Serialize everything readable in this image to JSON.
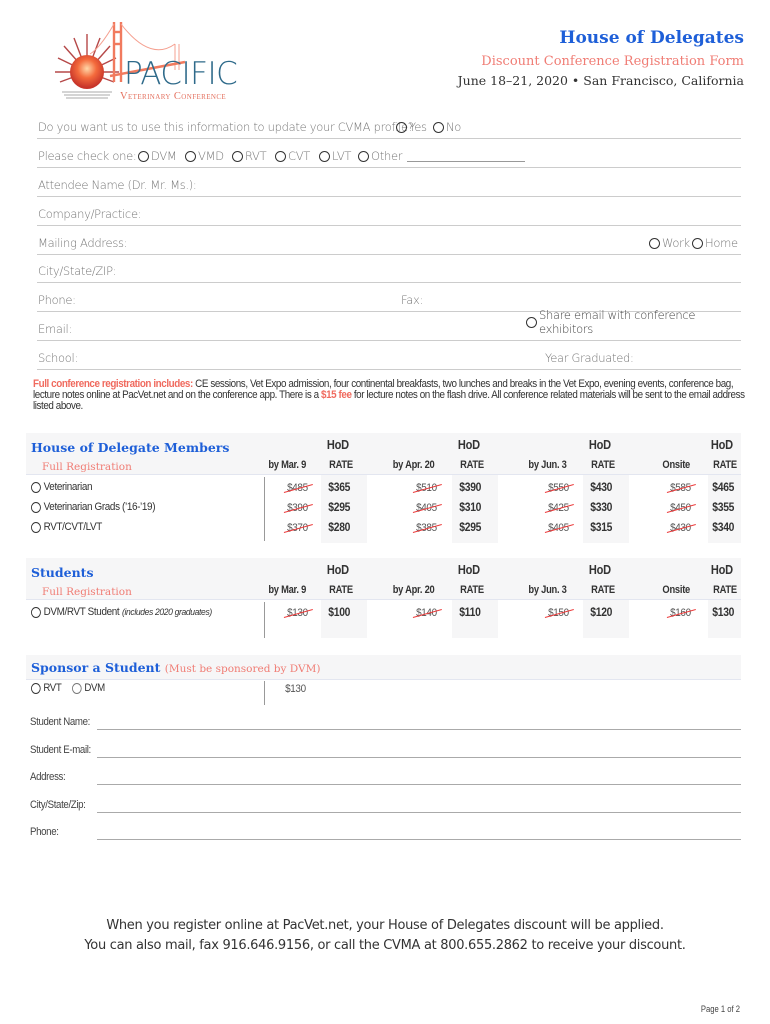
{
  "logo": {
    "name": "PACIFIC",
    "subtitle": "Veterinary Conference",
    "icon": "golden-gate-bridge-sun-icon"
  },
  "header": {
    "title": "House of Delegates",
    "subtitle": "Discount Conference Registration Form",
    "date_location": "June 18–21, 2020 •  San Francisco, California"
  },
  "colors": {
    "blue": "#1e5fd8",
    "coral": "#f07d75",
    "strike_red": "#ec3a3a",
    "band_gray": "#f6f6f7"
  },
  "form": {
    "update_profile": {
      "label": "Do you want us to use this information to update your CVMA profile?",
      "options": [
        "Yes",
        "No"
      ]
    },
    "check_one": {
      "label": "Please check one:",
      "options": [
        "DVM",
        "VMD",
        "RVT",
        "CVT",
        "LVT",
        "Other"
      ]
    },
    "attendee_name": "Attendee Name (Dr. Mr. Ms.):",
    "company": "Company/Practice:",
    "mailing_address": {
      "label": "Mailing Address:",
      "options": [
        "Work",
        "Home"
      ]
    },
    "city_state_zip": "City/State/ZIP:",
    "phone": "Phone:",
    "fax": "Fax:",
    "email": {
      "label": "Email:",
      "share_option": "Share email with conference exhibitors"
    },
    "school": "School:",
    "year_graduated": "Year Graduated:"
  },
  "note": {
    "lead": "Full conference registration includes:",
    "body1": " CE sessions, Vet Expo admission, four continental breakfasts, two lunches and breaks in the Vet Expo, evening events, conference bag, lecture notes online at PacVet.net and on the conference app. There is a ",
    "fee": "$15 fee",
    "body2": " for lecture notes on the flash drive. All conference related materials will be sent to the email address listed above."
  },
  "columns": {
    "hod": "HoD",
    "rate": "RATE",
    "periods": [
      "by Mar. 9",
      "by Apr. 20",
      "by Jun. 3",
      "Onsite"
    ]
  },
  "members_table": {
    "title": "House of Delegate Members",
    "subtitle": "Full Registration",
    "rows": [
      {
        "label": "Veterinarian",
        "regular": [
          "$485",
          "$510",
          "$550",
          "$585"
        ],
        "hod": [
          "$365",
          "$390",
          "$430",
          "$465"
        ]
      },
      {
        "label": "Veterinarian Grads (’16-’19)",
        "regular": [
          "$390",
          "$405",
          "$425",
          "$450"
        ],
        "hod": [
          "$295",
          "$310",
          "$330",
          "$355"
        ]
      },
      {
        "label": "RVT/CVT/LVT",
        "regular": [
          "$370",
          "$385",
          "$405",
          "$430"
        ],
        "hod": [
          "$280",
          "$295",
          "$315",
          "$340"
        ]
      }
    ]
  },
  "students_table": {
    "title": "Students",
    "subtitle": "Full Registration",
    "rows": [
      {
        "label": "DVM/RVT Student",
        "label_note": "includes 2020 graduates",
        "regular": [
          "$130",
          "$140",
          "$150",
          "$160"
        ],
        "hod": [
          "$100",
          "$110",
          "$120",
          "$130"
        ]
      }
    ]
  },
  "sponsor": {
    "title": "Sponsor a Student",
    "note": "(Must be sponsored by DVM)",
    "options": [
      "RVT",
      "DVM"
    ],
    "price": "$130",
    "fields": [
      "Student Name:",
      "Student E-mail:",
      "Address:",
      "City/State/Zip:",
      "Phone:"
    ]
  },
  "footer": {
    "line1": "When you register online at PacVet.net, your House of Delegates discount will be applied.",
    "line2": "You can also mail, fax 916.646.9156, or call the CVMA at 800.655.2862 to receive your discount."
  },
  "page": "Page 1 of 2"
}
